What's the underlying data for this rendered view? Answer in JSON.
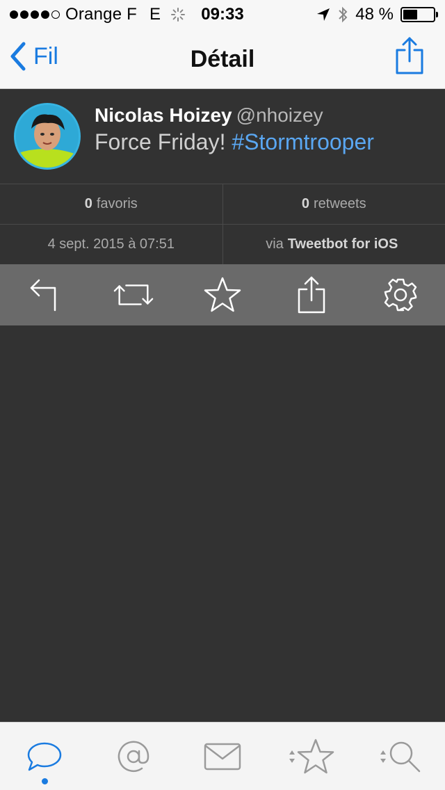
{
  "status_bar": {
    "carrier": "Orange F",
    "network": "E",
    "time": "09:33",
    "battery": "48 %",
    "battery_level": 0.48
  },
  "nav": {
    "back_label": "Fil",
    "title": "Détail"
  },
  "tweet": {
    "name": "Nicolas Hoizey",
    "handle": "@nhoizey",
    "text": "Force Friday! ",
    "hashtag": "#Stormtrooper"
  },
  "stats": {
    "favorites_count": "0",
    "favorites_label": "favoris",
    "retweets_count": "0",
    "retweets_label": "retweets",
    "date": "4 sept. 2015 à 07:51",
    "via_prefix": "via",
    "client": "Tweetbot for iOS"
  },
  "actions": [
    "reply-icon",
    "retweet-icon",
    "star-icon",
    "share-icon",
    "gear-icon"
  ],
  "tabs": [
    "timeline-icon",
    "mentions-icon",
    "messages-icon",
    "favorites-icon",
    "search-icon"
  ],
  "colors": {
    "accent": "#1a7be0",
    "hashtag": "#5aa7f2",
    "background": "#323232",
    "toolbar": "#6a6a6a"
  }
}
